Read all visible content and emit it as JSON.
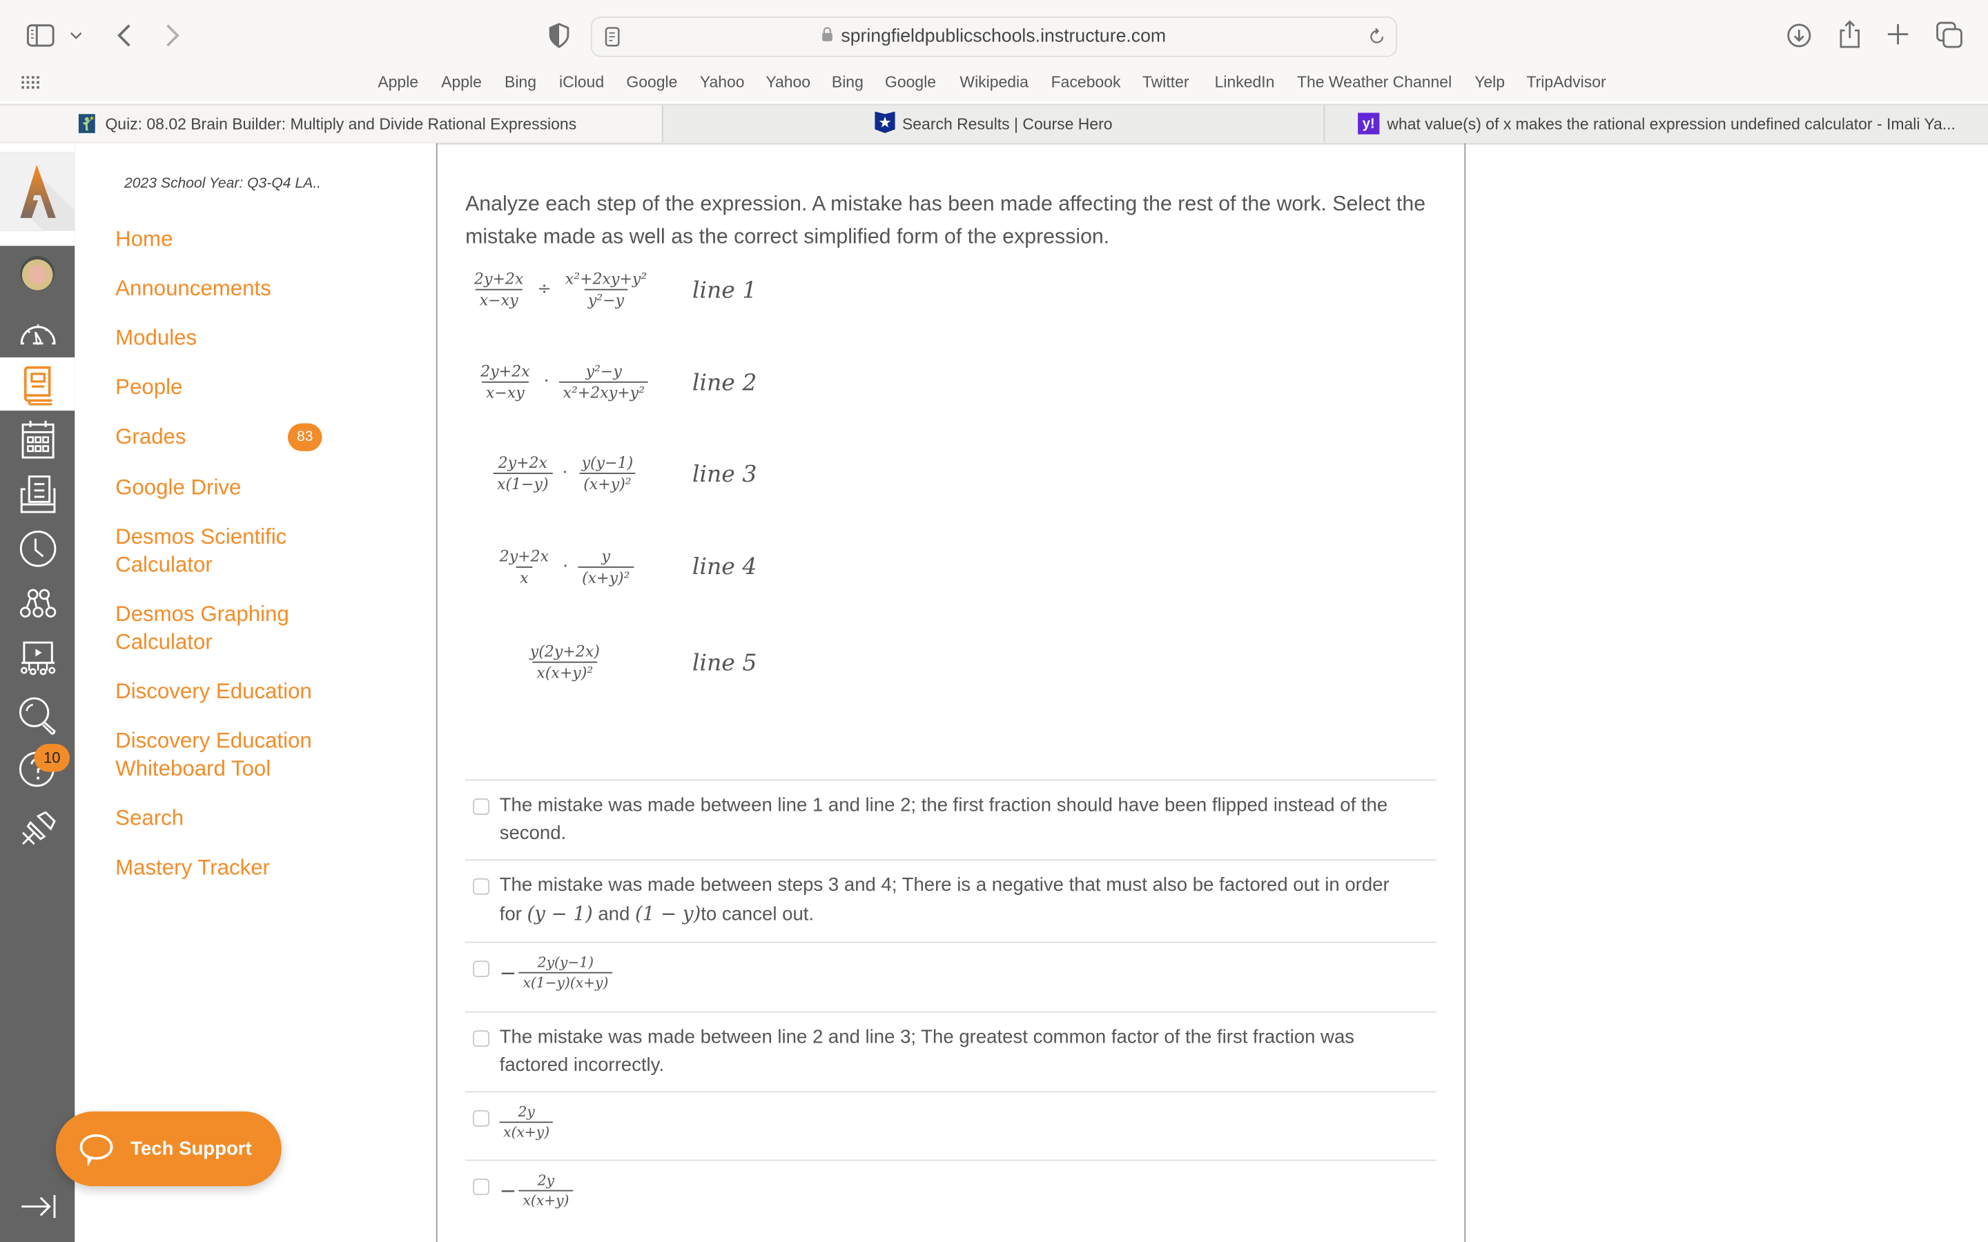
{
  "browser": {
    "url": "springfieldpublicschools.instructure.com",
    "toolbar_icons": [
      "sidebar-icon",
      "chevron-down-icon",
      "back-icon",
      "forward-icon",
      "shield-icon",
      "reader-icon",
      "lock-icon",
      "reload-icon",
      "download-icon",
      "share-icon",
      "new-tab-icon",
      "tab-overview-icon"
    ],
    "bookmarks": [
      "Apple",
      "Apple",
      "Bing",
      "iCloud",
      "Google",
      "Yahoo",
      "Yahoo",
      "Bing",
      "Google",
      "Wikipedia",
      "Facebook",
      "Twitter",
      "LinkedIn",
      "The Weather Channel",
      "Yelp",
      "TripAdvisor"
    ],
    "tabs": [
      {
        "title": "Quiz: 08.02 Brain Builder: Multiply and Divide Rational Expressions",
        "icon": "school-favicon",
        "active": true
      },
      {
        "title": "Search Results | Course Hero",
        "icon": "coursehero-favicon",
        "active": false
      },
      {
        "title": "what value(s) of x makes the rational expression undefined calculator - Imali Ya...",
        "icon": "yahoo-favicon",
        "active": false
      }
    ]
  },
  "global_nav": {
    "items": [
      {
        "name": "account",
        "icon": "avatar"
      },
      {
        "name": "dashboard",
        "icon": "dashboard-icon"
      },
      {
        "name": "courses",
        "icon": "courses-icon",
        "active": true
      },
      {
        "name": "calendar",
        "icon": "calendar-icon"
      },
      {
        "name": "inbox",
        "icon": "inbox-icon"
      },
      {
        "name": "history",
        "icon": "clock-icon"
      },
      {
        "name": "commons",
        "icon": "commons-icon"
      },
      {
        "name": "studio",
        "icon": "studio-icon"
      },
      {
        "name": "search",
        "icon": "search-icon"
      },
      {
        "name": "help",
        "icon": "help-icon",
        "badge": "10"
      },
      {
        "name": "pin",
        "icon": "pin-icon"
      }
    ],
    "collapse_icon": "collapse-icon"
  },
  "course_nav": {
    "course_title": "2023 School Year: Q3-Q4 LA..",
    "items": [
      {
        "label": "Home"
      },
      {
        "label": "Announcements"
      },
      {
        "label": "Modules"
      },
      {
        "label": "People"
      },
      {
        "label": "Grades",
        "badge": "83"
      },
      {
        "label": "Google Drive"
      },
      {
        "label": "Desmos Scientific Calculator"
      },
      {
        "label": "Desmos Graphing Calculator"
      },
      {
        "label": "Discovery Education"
      },
      {
        "label": "Discovery Education Whiteboard Tool"
      },
      {
        "label": "Search"
      },
      {
        "label": "Mastery Tracker"
      }
    ]
  },
  "question": {
    "prompt": "Analyze each step of the expression. A mistake has been made affecting the rest of the work. Select the mistake made as well as the correct simplified form of the expression.",
    "lines": [
      {
        "label": "line 1",
        "terms": [
          {
            "num": "2y+2x",
            "den": "x−xy"
          },
          {
            "op": "÷"
          },
          {
            "num": "x²+2xy+y²",
            "den": "y²−y"
          }
        ]
      },
      {
        "label": "line 2",
        "terms": [
          {
            "num": "2y+2x",
            "den": "x−xy"
          },
          {
            "op": "·"
          },
          {
            "num": "y²−y",
            "den": "x²+2xy+y²"
          }
        ]
      },
      {
        "label": "line 3",
        "terms": [
          {
            "num": "2y+2x",
            "den": "x(1−y)"
          },
          {
            "op": "·"
          },
          {
            "num": "y(y−1)",
            "den": "(x+y)²"
          }
        ]
      },
      {
        "label": "line 4",
        "terms": [
          {
            "num": "2y+2x",
            "den": "x"
          },
          {
            "op": "·"
          },
          {
            "num": "y",
            "den": "(x+y)²"
          }
        ]
      },
      {
        "label": "line 5",
        "terms": [
          {
            "num": "y(2y+2x)",
            "den": "x(x+y)²"
          }
        ]
      }
    ],
    "answers": [
      {
        "type": "text",
        "text": "The mistake was made between line 1 and line 2; the first fraction should have been flipped instead of the second.",
        "checked": false
      },
      {
        "type": "text",
        "text_before": "The mistake was made between steps 3 and 4; There is a negative that must also be factored out in order for ",
        "math1": "(y − 1)",
        "text_mid": " and ",
        "math2": "(1 − y)",
        "text_after": "to cancel out.",
        "checked": false
      },
      {
        "type": "math",
        "sign": "−",
        "num": "2y(y−1)",
        "den": "x(1−y)(x+y)",
        "checked": false
      },
      {
        "type": "text",
        "text": "The mistake was made between line 2 and line 3; The greatest common factor of the first fraction was factored incorrectly.",
        "checked": false
      },
      {
        "type": "math",
        "sign": "",
        "num": "2y",
        "den": "x(x+y)",
        "checked": false
      },
      {
        "type": "math",
        "sign": "−",
        "num": "2y",
        "den": "x(x+y)",
        "checked": false
      }
    ]
  },
  "tech_support": {
    "label": "Tech Support",
    "icon": "chat-bubble-icon"
  },
  "colors": {
    "accent": "#f28c28",
    "global_nav_bg": "#646464",
    "text": "#555555"
  }
}
